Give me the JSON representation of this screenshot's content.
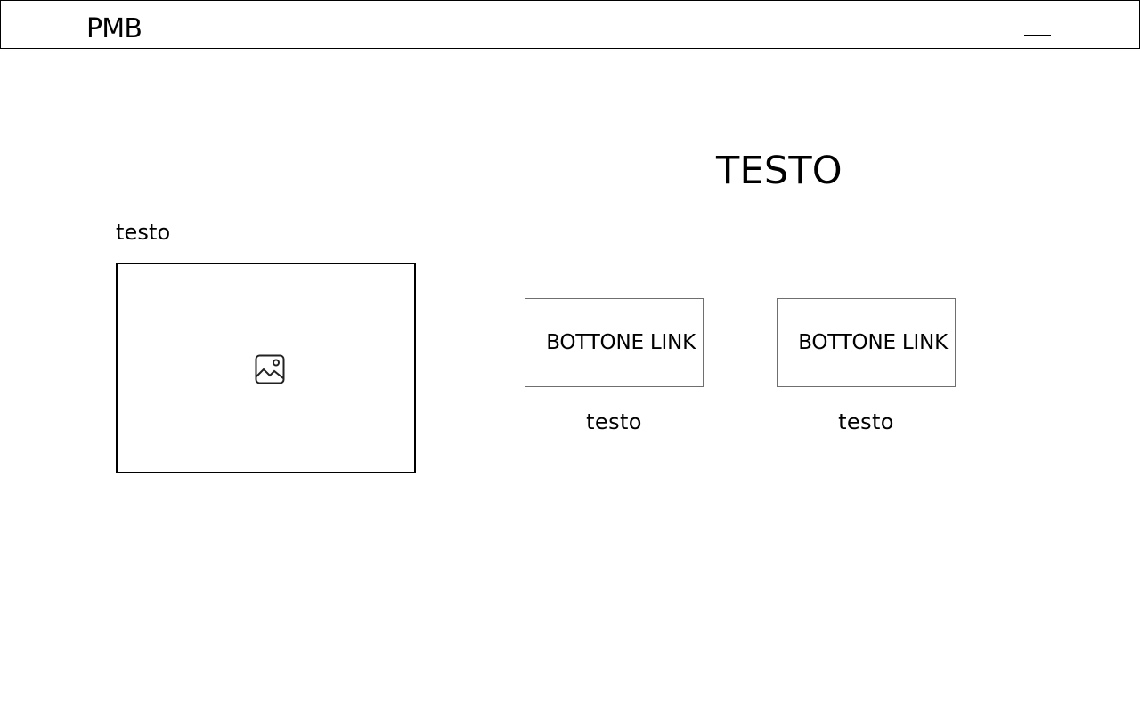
{
  "header": {
    "logo": "PMB",
    "menu_icon": "hamburger-menu-icon"
  },
  "left_section": {
    "label": "testo",
    "image_icon": "image-placeholder-icon"
  },
  "main": {
    "title": "TESTO",
    "cards": [
      {
        "button_label": "BOTTONE LINK",
        "caption": "testo"
      },
      {
        "button_label": "BOTTONE LINK",
        "caption": "testo"
      }
    ]
  },
  "colors": {
    "background": "#ffffff",
    "text": "#000000",
    "button_border": "#6f6f6f"
  }
}
